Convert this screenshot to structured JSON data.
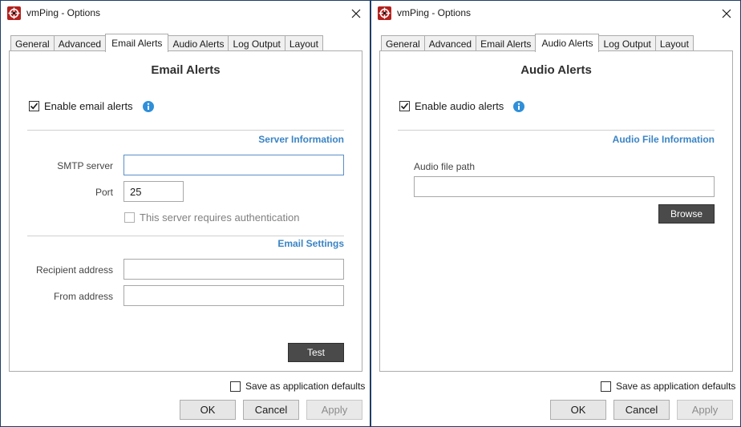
{
  "left": {
    "title": "vmPing - Options",
    "tabs": [
      "General",
      "Advanced",
      "Email Alerts",
      "Audio Alerts",
      "Log Output",
      "Layout"
    ],
    "active_tab": 2,
    "panel_title": "Email Alerts",
    "enable_label": "Enable email alerts",
    "enable_checked": true,
    "server_section": "Server Information",
    "smtp_label": "SMTP server",
    "smtp_value": "",
    "port_label": "Port",
    "port_value": "25",
    "auth_label": "This server requires authentication",
    "email_section": "Email Settings",
    "recipient_label": "Recipient address",
    "recipient_value": "",
    "from_label": "From address",
    "from_value": "",
    "test_label": "Test",
    "save_defaults_label": "Save as application defaults",
    "ok_label": "OK",
    "cancel_label": "Cancel",
    "apply_label": "Apply"
  },
  "right": {
    "title": "vmPing - Options",
    "tabs": [
      "General",
      "Advanced",
      "Email Alerts",
      "Audio Alerts",
      "Log Output",
      "Layout"
    ],
    "active_tab": 3,
    "panel_title": "Audio Alerts",
    "enable_label": "Enable audio alerts",
    "enable_checked": true,
    "audio_section": "Audio File Information",
    "audio_path_label": "Audio file path",
    "audio_path_value": "",
    "browse_label": "Browse",
    "save_defaults_label": "Save as application defaults",
    "ok_label": "OK",
    "cancel_label": "Cancel",
    "apply_label": "Apply"
  },
  "colors": {
    "accent": "#3a84c5",
    "info_icon": "#2f8fd8",
    "dark_button": "#4a4a4a",
    "window_border": "#1e3f66"
  },
  "icons": {
    "app": "vmping-app-icon",
    "close": "close-icon",
    "info": "info-icon",
    "check": "checkmark-icon"
  }
}
